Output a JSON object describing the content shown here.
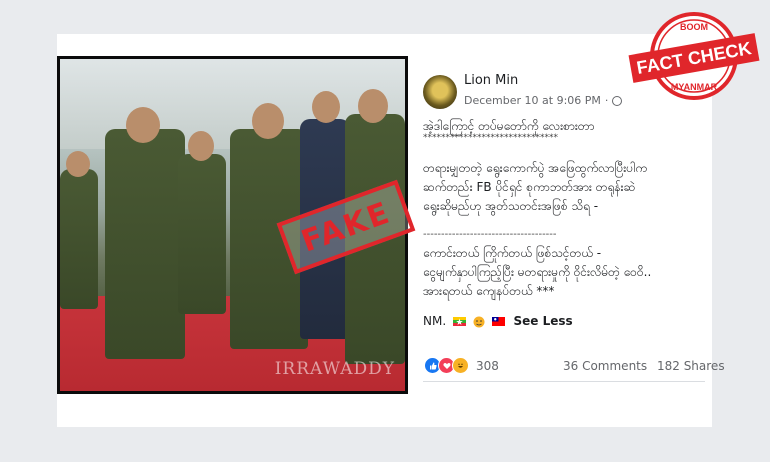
{
  "post": {
    "author": "Lion Min",
    "date": "December 10 at 9:06 PM",
    "dot": "·",
    "more": "···",
    "lines": [
      "အဲ့ဒါကြောင့် တပ်မတော်ကို လေးစားတာ",
      "******************************",
      "တရားမျှတတဲ့ ရွေးကောက်ပွဲ အဖြေထွက်လာပြီးပါက",
      "ဆက်တည်း FB ပိုင်ရှင် စုကာဘတ်အား တရုန်းဆဲ",
      "ရွေးဆိုမည်ဟု အွတ်သတင်းအဖြစ် သိရ -",
      "-------------------------------------",
      "ကောင်းတယ် ကြိုက်တယ် ဖြစ်သင့်တယ် -",
      "ငွေမျက်နှာပါကြည့်ပြီး မတရားမှုကို ဝိုင်းလိမ်တဲ့ ဝေဝိ..",
      "အားရတယ် ကျေနပ်တယ် ***"
    ],
    "signature": "NM.",
    "see_less": "See Less",
    "reaction_count": "308",
    "comments": "36 Comments",
    "shares": "182 Shares"
  },
  "photo": {
    "watermark": "IRRAWADDY",
    "stamp": "FAKE"
  },
  "badge": {
    "top": "BOOM",
    "main": "FACT CHECK",
    "bottom": "MYANMAR"
  },
  "colors": {
    "stamp_red": "#e0262b",
    "badge_red": "#e0262b",
    "like_blue": "#1877f2"
  }
}
